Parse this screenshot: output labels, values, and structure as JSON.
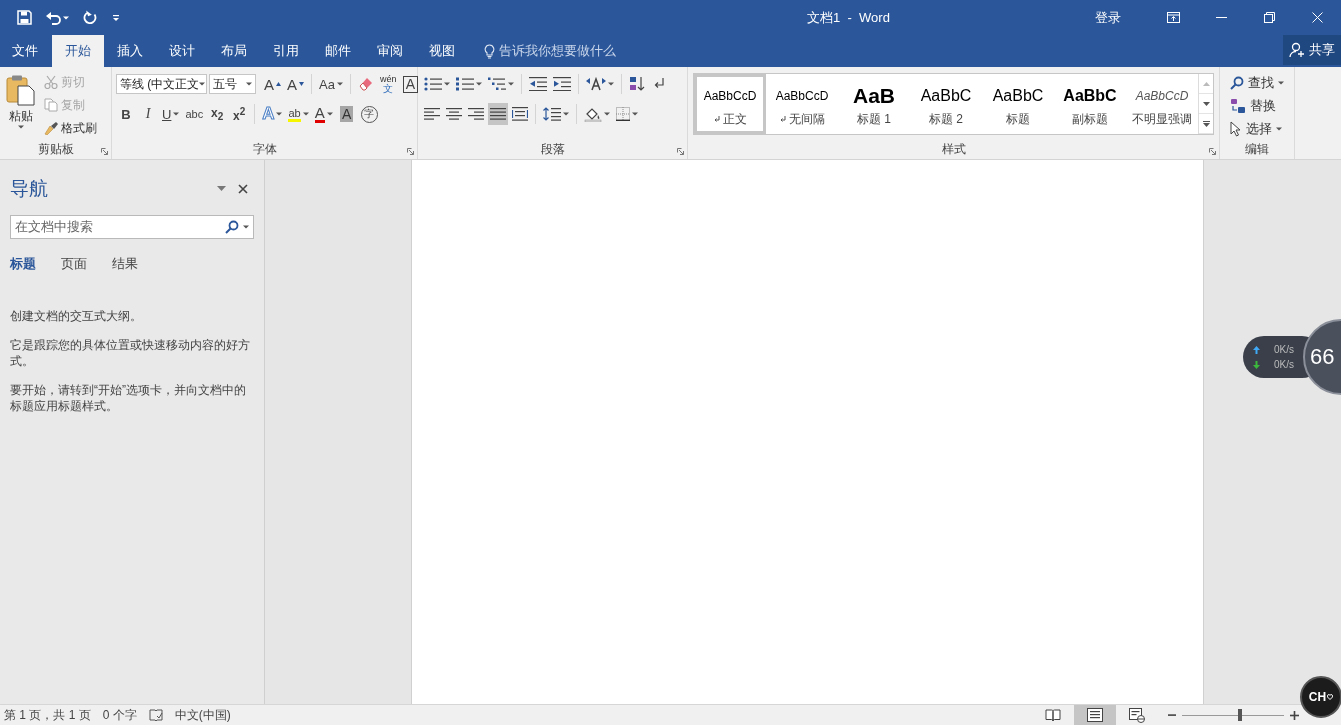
{
  "title_bar": {
    "title": "文档1  -  Word",
    "sign_in": "登录"
  },
  "tabs": [
    {
      "label": "文件",
      "selected": false
    },
    {
      "label": "开始",
      "selected": true
    },
    {
      "label": "插入",
      "selected": false
    },
    {
      "label": "设计",
      "selected": false
    },
    {
      "label": "布局",
      "selected": false
    },
    {
      "label": "引用",
      "selected": false
    },
    {
      "label": "邮件",
      "selected": false
    },
    {
      "label": "审阅",
      "selected": false
    },
    {
      "label": "视图",
      "selected": false
    }
  ],
  "tell_me": {
    "placeholder": "告诉我你想要做什么"
  },
  "share": {
    "label": "共享"
  },
  "ribbon": {
    "clipboard": {
      "label": "剪贴板",
      "paste": "粘贴",
      "actions": [
        {
          "label": "剪切",
          "kind": "cut",
          "disabled": true
        },
        {
          "label": "复制",
          "kind": "copy",
          "disabled": true
        },
        {
          "label": "格式刷",
          "kind": "painter",
          "disabled": false
        }
      ]
    },
    "font": {
      "label": "字体",
      "font_name": "等线 (中文正文",
      "font_size": "五号",
      "row1": [
        {
          "kind": "grow",
          "text": "A"
        },
        {
          "kind": "shrink",
          "text": "A"
        },
        {
          "kind": "case",
          "text": "Aa",
          "dropdown": true
        },
        {
          "kind": "clear"
        },
        {
          "kind": "phonetic",
          "text": "wén",
          "text2": "文"
        },
        {
          "kind": "border",
          "text": "A"
        }
      ],
      "row2": [
        {
          "kind": "bold",
          "text": "B"
        },
        {
          "kind": "italic",
          "text": "I"
        },
        {
          "kind": "underline",
          "text": "U",
          "dropdown": true
        },
        {
          "kind": "strike",
          "text": "abc"
        },
        {
          "kind": "subscript",
          "text": "x$_{2}$"
        },
        {
          "kind": "superscript",
          "text": "x$^{2}$"
        },
        {
          "kind": "effects",
          "text": "A",
          "dropdown": true
        },
        {
          "kind": "highlight",
          "text": "ab",
          "dropdown": true
        },
        {
          "kind": "color",
          "text": "A",
          "dropdown": true
        },
        {
          "kind": "shading",
          "text": "A"
        },
        {
          "kind": "enclose",
          "text": "字"
        }
      ]
    },
    "paragraph": {
      "label": "段落",
      "row1": [
        {
          "kind": "bullets",
          "dropdown": true
        },
        {
          "kind": "numbering",
          "dropdown": true
        },
        {
          "kind": "multilevel",
          "dropdown": true
        },
        {
          "kind": "outdent",
          "dropdown": false
        },
        {
          "kind": "indent",
          "dropdown": false
        },
        {
          "kind": "asian",
          "dropdown": true
        },
        {
          "kind": "sort",
          "dropdown": false
        },
        {
          "kind": "marks",
          "dropdown": false
        }
      ],
      "alignment": [
        {
          "kind": "left",
          "selected": false
        },
        {
          "kind": "center",
          "selected": false
        },
        {
          "kind": "right",
          "selected": false
        },
        {
          "kind": "justify",
          "selected": true
        },
        {
          "kind": "distribute",
          "selected": false
        }
      ],
      "row2": [
        {
          "kind": "spacing",
          "dropdown": true
        },
        {
          "kind": "fill",
          "dropdown": true
        },
        {
          "kind": "borders",
          "dropdown": true
        }
      ]
    },
    "styles": {
      "label": "样式",
      "items": [
        {
          "preview": "AaBbCcD",
          "name": "正文",
          "kind": "normal",
          "paragraph_mark": true,
          "selected": true
        },
        {
          "preview": "AaBbCcD",
          "name": "无间隔",
          "kind": "normal",
          "paragraph_mark": true,
          "selected": false
        },
        {
          "preview": "AaB",
          "name": "标题 1",
          "kind": "heading1",
          "paragraph_mark": false,
          "selected": false
        },
        {
          "preview": "AaBbC",
          "name": "标题 2",
          "kind": "heading2",
          "paragraph_mark": false,
          "selected": false
        },
        {
          "preview": "AaBbC",
          "name": "标题",
          "kind": "title",
          "paragraph_mark": false,
          "selected": false
        },
        {
          "preview": "AaBbC",
          "name": "副标题",
          "kind": "subtitle",
          "paragraph_mark": false,
          "selected": false
        },
        {
          "preview": "AaBbCcD",
          "name": "不明显强调",
          "kind": "emphasis",
          "paragraph_mark": false,
          "selected": false
        }
      ]
    },
    "editing": {
      "label": "编辑",
      "items": [
        {
          "label": "查找",
          "kind": "find",
          "dropdown": true
        },
        {
          "label": "替换",
          "kind": "replace",
          "dropdown": false
        },
        {
          "label": "选择",
          "kind": "select",
          "dropdown": true
        }
      ]
    }
  },
  "navigation": {
    "title": "导航",
    "search": {
      "placeholder": "在文档中搜索"
    },
    "tabs": [
      {
        "label": "标题",
        "selected": true
      },
      {
        "label": "页面",
        "selected": false
      },
      {
        "label": "结果",
        "selected": false
      }
    ],
    "paragraphs": [
      "创建文档的交互式大纲。",
      "它是跟踪您的具体位置或快速移动内容的好方式。",
      "要开始，请转到“开始”选项卡，并向文档中的标题应用标题样式。"
    ]
  },
  "status_bar": {
    "page": "第 1 页，共 1 页",
    "words": "0 个字",
    "language": "中文(中国)",
    "views": [
      {
        "kind": "read",
        "selected": false
      },
      {
        "kind": "print",
        "selected": true
      },
      {
        "kind": "web",
        "selected": false
      }
    ],
    "zoom": {
      "level": 0.57
    }
  },
  "speed_widget": {
    "upload": "0K/s",
    "download": "0K/s",
    "gauge": "66"
  },
  "ime_badge": {
    "label": "CH"
  }
}
